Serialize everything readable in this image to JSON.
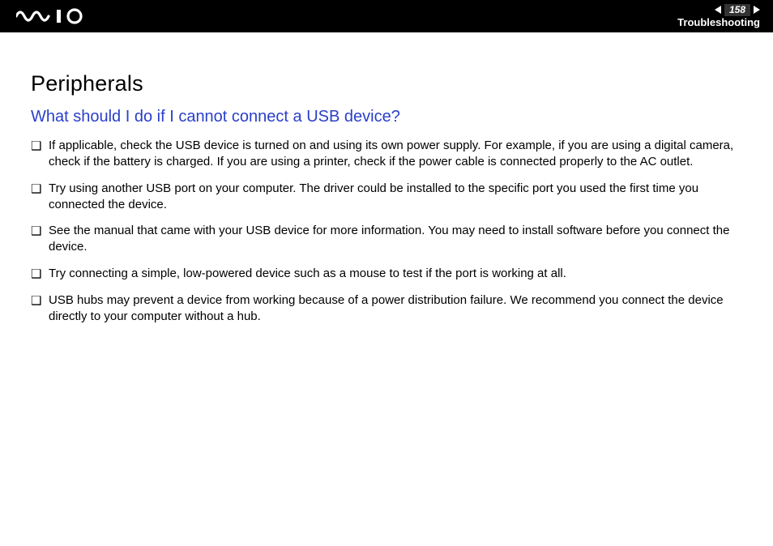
{
  "header": {
    "page_number": "158",
    "section": "Troubleshooting"
  },
  "content": {
    "title": "Peripherals",
    "question": "What should I do if I cannot connect a USB device?",
    "bullets": [
      "If applicable, check the USB device is turned on and using its own power supply. For example, if you are using a digital camera, check if the battery is charged. If you are using a printer, check if the power cable is connected properly to the AC outlet.",
      "Try using another USB port on your computer. The driver could be installed to the specific port you used the first time you connected the device.",
      "See the manual that came with your USB device for more information. You may need to install software before you connect the device.",
      "Try connecting a simple, low-powered device such as a mouse to test if the port is working at all.",
      "USB hubs may prevent a device from working because of a power distribution failure. We recommend you connect the device directly to your computer without a hub."
    ]
  }
}
